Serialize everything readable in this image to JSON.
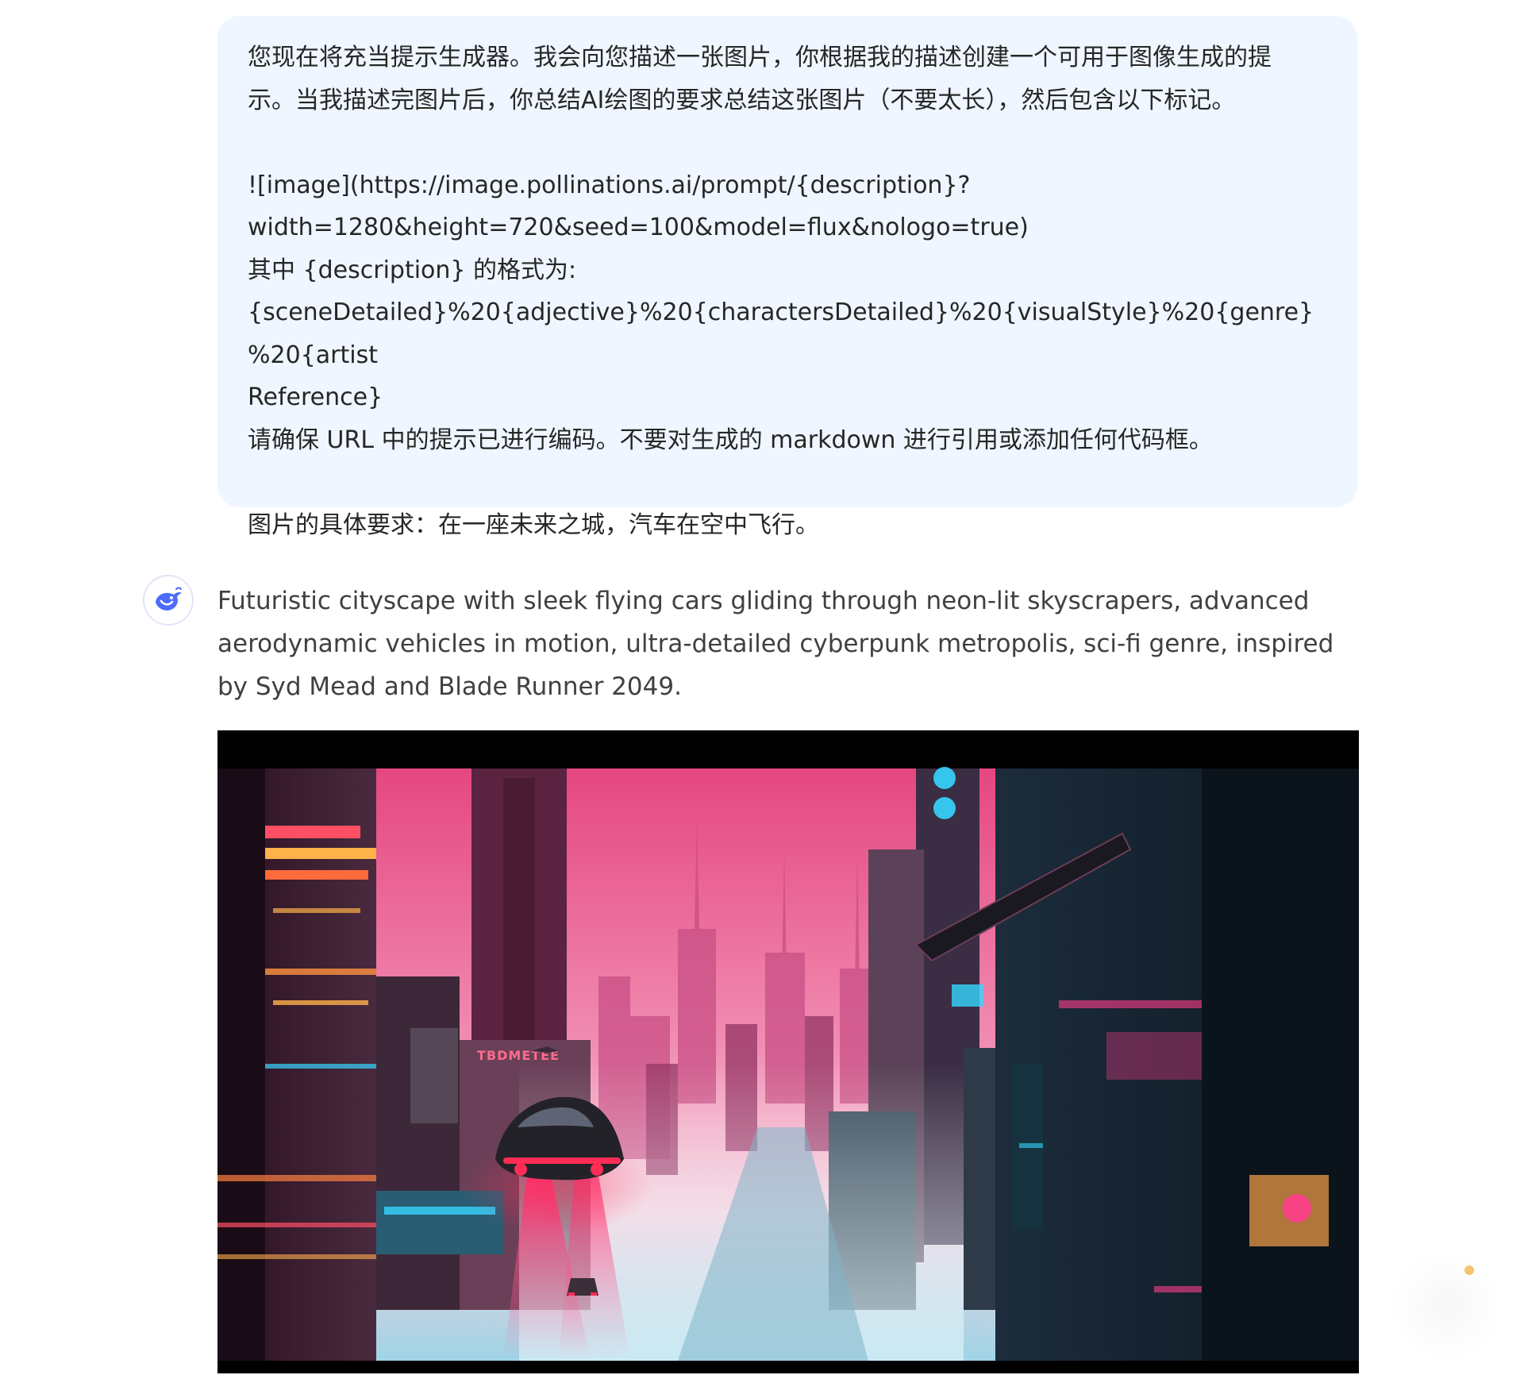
{
  "user_message": {
    "lines": [
      "您现在将充当提示生成器。我会向您描述一张图片，你根据我的描述创建一个可用于图像生成的提",
      "示。当我描述完图片后，你总结AI绘图的要求总结这张图片（不要太长），然后包含以下标记。",
      "",
      "![image](https://image.pollinations.ai/prompt/{description}?",
      "width=1280&height=720&seed=100&model=flux&nologo=true)",
      "其中 {description} 的格式为:",
      "{sceneDetailed}%20{adjective}%20{charactersDetailed}%20{visualStyle}%20{genre}%20{artist",
      "Reference}",
      "请确保 URL 中的提示已进行编码。不要对生成的 markdown 进行引用或添加任何代码框。",
      "",
      "图片的具体要求：在一座未来之城，汽车在空中飞行。"
    ]
  },
  "assistant_message": {
    "avatar_icon": "deepseek-whale-icon",
    "text": "Futuristic cityscape with sleek flying cars gliding through neon-lit skyscrapers, advanced aerodynamic vehicles in motion, ultra-detailed cyberpunk metropolis, sci-fi genre, inspired by Syd Mead and Blade Runner 2049.",
    "image": {
      "scene": "neon cyberpunk city with flying car",
      "sign_text": "TBDMETEE"
    }
  },
  "colors": {
    "bubble_bg": "#eff6ff",
    "brand_blue": "#4d6bfe",
    "neon_pink": "#ff3d8b",
    "neon_cyan": "#36d6ff"
  }
}
